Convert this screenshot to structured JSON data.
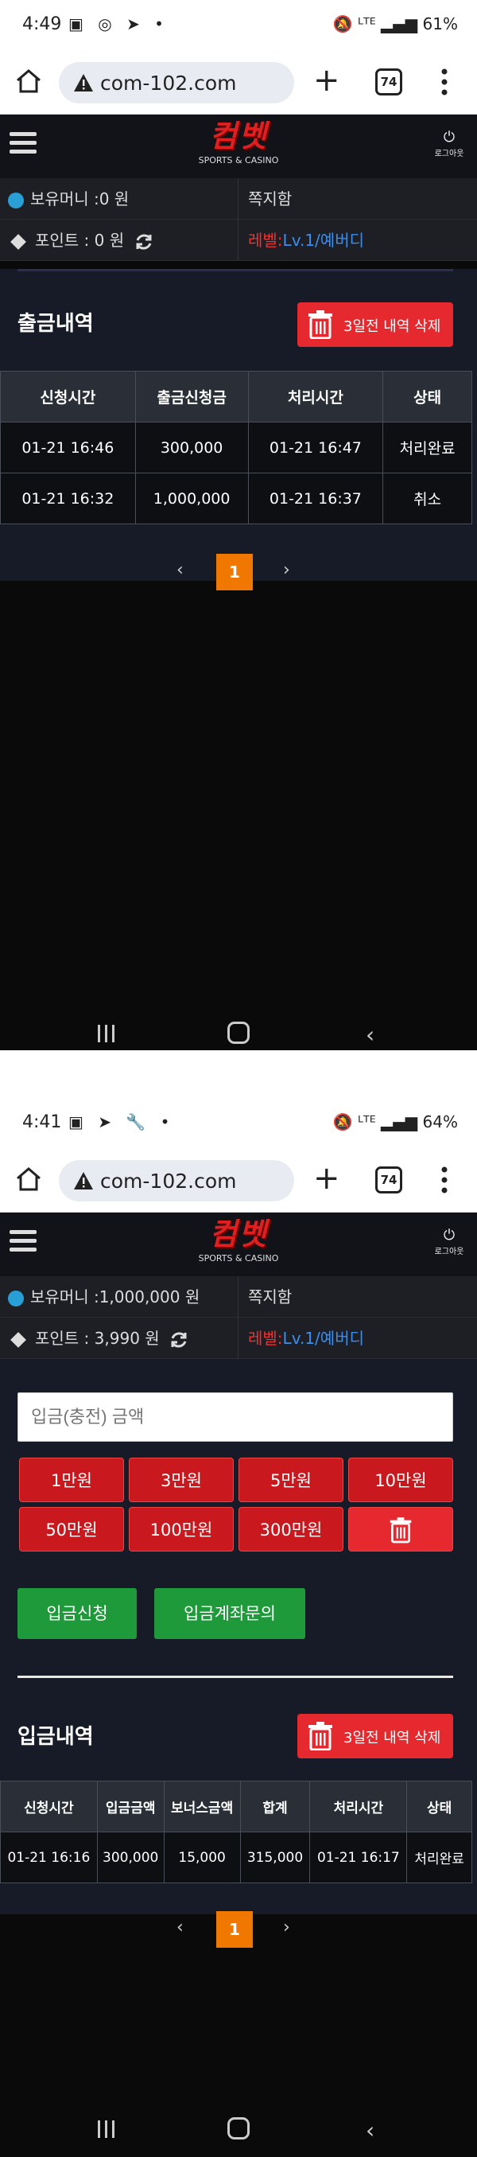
{
  "screens": [
    {
      "status": {
        "time": "4:49",
        "battery": "61%"
      },
      "browser": {
        "url": "com-102.com",
        "tab_count": "74"
      },
      "header": {
        "logo_main": "컴벳",
        "logo_sub": "SPORTS & CASINO",
        "logout_label": "로그아웃"
      },
      "info": {
        "money": "보유머니 :0 원",
        "message": "쪽지함",
        "point_label": "포인트 :",
        "point_value": "0 원",
        "level_prefix": "레벨:",
        "level_value": "Lv.1/예버디"
      },
      "section": {
        "title": "출금내역",
        "delete_label": "3일전 내역 삭제"
      },
      "table": {
        "headers": [
          "신청시간",
          "출금신청금",
          "처리시간",
          "상태"
        ],
        "rows": [
          [
            "01-21 16:46",
            "300,000",
            "01-21 16:47",
            "처리완료"
          ],
          [
            "01-21 16:32",
            "1,000,000",
            "01-21 16:37",
            "취소"
          ]
        ]
      },
      "pager": {
        "prev": "‹",
        "current": "1",
        "next": "›"
      }
    },
    {
      "status": {
        "time": "4:41",
        "battery": "64%"
      },
      "browser": {
        "url": "com-102.com",
        "tab_count": "74"
      },
      "header": {
        "logo_main": "컴벳",
        "logo_sub": "SPORTS & CASINO",
        "logout_label": "로그아웃"
      },
      "info": {
        "money": "보유머니 :1,000,000 원",
        "message": "쪽지함",
        "point_label": "포인트 :",
        "point_value": "3,990 원",
        "level_prefix": "레벨:",
        "level_value": "Lv.1/예버디"
      },
      "deposit": {
        "placeholder": "입금(충전) 금액",
        "amounts": [
          "1만원",
          "3만원",
          "5만원",
          "10만원",
          "50만원",
          "100만원",
          "300만원"
        ],
        "apply_label": "입금신청",
        "account_label": "입금계좌문의"
      },
      "section": {
        "title": "입금내역",
        "delete_label": "3일전 내역 삭제"
      },
      "table": {
        "headers": [
          "신청시간",
          "입금금액",
          "보너스금액",
          "합계",
          "처리시간",
          "상태"
        ],
        "rows": [
          [
            "01-21 16:16",
            "300,000",
            "15,000",
            "315,000",
            "01-21 16:17",
            "처리완료"
          ]
        ]
      },
      "pager": {
        "prev": "‹",
        "current": "1",
        "next": "›"
      }
    }
  ],
  "colors": {
    "accent_red": "#e5292e",
    "pager_orange": "#f07800",
    "green": "#1f9a3a",
    "level_blue": "#3a8ef0"
  },
  "icons": [
    "home-icon",
    "warning-icon",
    "plus-icon",
    "tabs-icon",
    "more-icon",
    "hamburger-icon",
    "power-icon",
    "coin-icon",
    "diamond-icon",
    "refresh-icon",
    "trash-icon",
    "recents-icon",
    "back-icon"
  ]
}
